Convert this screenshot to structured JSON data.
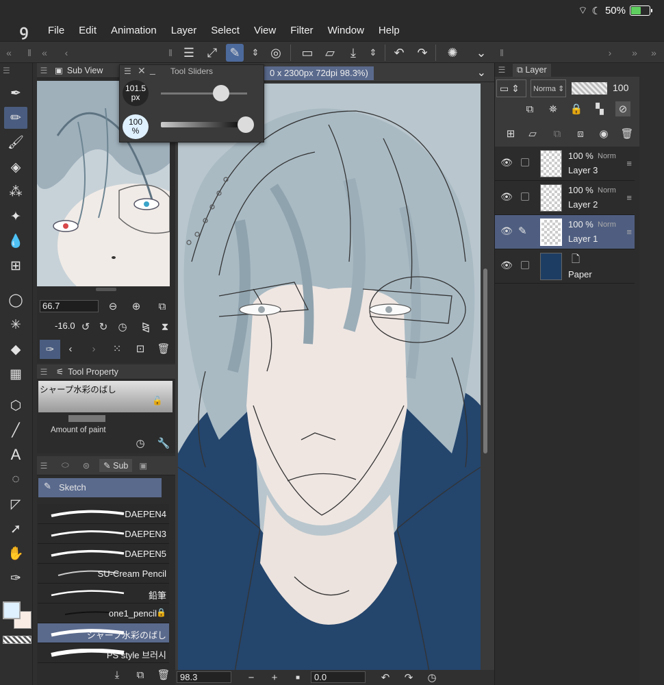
{
  "status": {
    "battery_pct": "50%",
    "battery_level": 0.5
  },
  "menu": {
    "logo": "ꝯ",
    "items": [
      "File",
      "Edit",
      "Animation",
      "Layer",
      "Select",
      "View",
      "Filter",
      "Window",
      "Help"
    ]
  },
  "subview": {
    "title": "Sub View",
    "zoom": "66.7",
    "angle": "-16.0"
  },
  "tool_sliders": {
    "title": "Tool Sliders",
    "size_value": "101.5",
    "size_unit": "px",
    "opacity_value": "100",
    "opacity_unit": "%"
  },
  "tool_property": {
    "title": "Tool Property",
    "preset_name": "シャープ水彩のばし",
    "amount_label": "Amount of paint"
  },
  "sub_tool": {
    "tab_label": "Sub",
    "group": "Sketch",
    "brushes": [
      "DAEPEN4",
      "DAEPEN3",
      "DAEPEN5",
      "SU-Cream Pencil",
      "鉛筆",
      "one1_pencil",
      "シャープ水彩のばし",
      "PS style 브러시"
    ]
  },
  "canvas": {
    "info": "0 x 2300px 72dpi 98.3%)",
    "zoom": "98.3",
    "rotation": "0.0"
  },
  "layer_panel": {
    "title": "Layer",
    "blend_mode": "Norma",
    "opacity": "100",
    "layers": [
      {
        "pct": "100 %",
        "mode": "Norm",
        "name": "Layer 3"
      },
      {
        "pct": "100 %",
        "mode": "Norm",
        "name": "Layer 2"
      },
      {
        "pct": "100 %",
        "mode": "Norm",
        "name": "Layer 1"
      },
      {
        "pct": "",
        "mode": "",
        "name": "Paper"
      }
    ]
  },
  "colors": {
    "main": "#dff1ff",
    "sub": "#f8ece4",
    "accent": "#4d6a9c",
    "paper": "#1e3d63"
  }
}
